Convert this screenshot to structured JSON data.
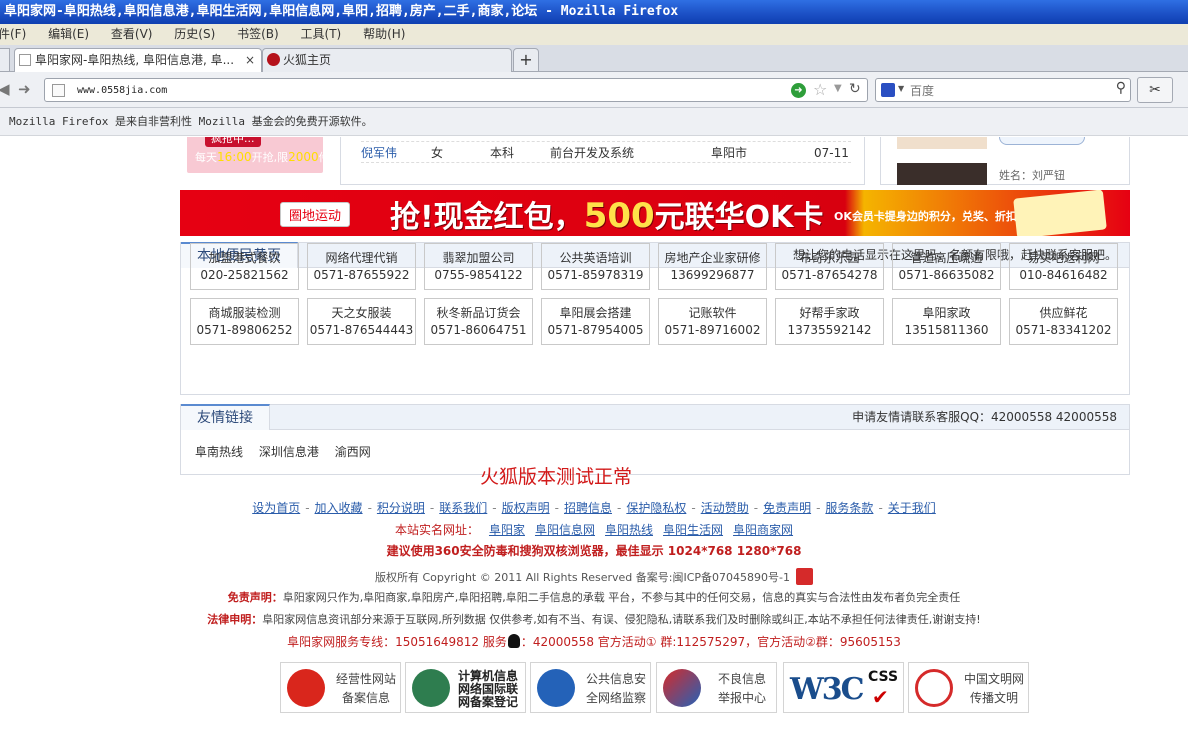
{
  "window": {
    "title": "阜阳家网-阜阳热线,阜阳信息港,阜阳生活网,阜阳信息网,阜阳,招聘,房产,二手,商家,论坛 - Mozilla Firefox"
  },
  "menu": [
    "件(F)",
    "编辑(E)",
    "查看(V)",
    "历史(S)",
    "书签(B)",
    "工具(T)",
    "帮助(H)"
  ],
  "tabs": [
    {
      "label": "阜阳家网-阜阳热线, 阜阳信息港, 阜...",
      "close": "×"
    },
    {
      "label": "火狐主页"
    }
  ],
  "newtab_label": "+",
  "nav": {
    "url": "www.0558jia.com",
    "search_placeholder": "百度"
  },
  "notification": "Mozilla Firefox 是来自非营利性 Mozilla 基金会的免费开源软件。",
  "promo": {
    "title": "疯抢中...",
    "text_prefix": "每天",
    "time": "16:00",
    "text_mid": "开抢,限",
    "count": "2000",
    "text_suffix": "件"
  },
  "job_row": {
    "name": "倪军伟",
    "gender": "女",
    "education": "本科",
    "position": "前台开发及系统",
    "city": "阜阳市",
    "date": "07-11"
  },
  "right_box": {
    "cut_text": "姓名：刘严钮"
  },
  "banner": {
    "tag": "圈地运动",
    "text": "抢!现金红包，",
    "amount": "500",
    "text2": "元联华OK卡",
    "card_note": "OK会员卡提身边的积分，兑奖、折扣卡"
  },
  "yellow_pages": {
    "title": "本地便民黄页",
    "note": "想让您的电话显示在这里吗，名额有限哦，赶快联系客服吧。",
    "entries": [
      {
        "name": "加盟港式餐饮",
        "phone": "020-25821562"
      },
      {
        "name": "网络代理代销",
        "phone": "0571-87655922"
      },
      {
        "name": "翡翠加盟公司",
        "phone": "0755-9854122"
      },
      {
        "name": "公共英语培训",
        "phone": "0571-85978319"
      },
      {
        "name": "房地产企业家研修",
        "phone": "13699296877"
      },
      {
        "name": "布奇乐乐园",
        "phone": "0571-87654278"
      },
      {
        "name": "管道高压疏通",
        "phone": "0571-86635082"
      },
      {
        "name": "易买吧返利网",
        "phone": "010-84616482"
      },
      {
        "name": "商城服装检测",
        "phone": "0571-89806252"
      },
      {
        "name": "天之女服装",
        "phone": "0571-876544443"
      },
      {
        "name": "秋冬新品订货会",
        "phone": "0571-86064751"
      },
      {
        "name": "阜阳展会搭建",
        "phone": "0571-87954005"
      },
      {
        "name": "记账软件",
        "phone": "0571-89716002"
      },
      {
        "name": "好帮手家政",
        "phone": "13735592142"
      },
      {
        "name": "阜阳家政",
        "phone": "13515811360"
      },
      {
        "name": "供应鲜花",
        "phone": "0571-83341202"
      }
    ]
  },
  "friend_links": {
    "title": "友情链接",
    "note": "申请友情请联系客服QQ：42000558 42000558",
    "links": [
      "阜南热线",
      "深圳信息港",
      "渝西网"
    ]
  },
  "test_note": "火狐版本测试正常",
  "footer": {
    "links": [
      "设为首页",
      "加入收藏",
      "积分说明",
      "联系我们",
      "版权声明",
      "招聘信息",
      "保护隐私权",
      "活动赞助",
      "免责声明",
      "服务条款",
      "关于我们"
    ],
    "realname_label": "本站实名网址：",
    "realname_links": [
      "阜阳家",
      "阜阳信息网",
      "阜阳热线",
      "阜阳生活网",
      "阜阳商家网"
    ],
    "advice": "建议使用360安全防毒和搜狗双核浏览器，最佳显示 1024*768 1280*768",
    "copyright": "版权所有 Copyright © 2011 All Rights Reserved 备案号:闽ICP备07045890号-1",
    "disclaimer_label": "免责声明：",
    "disclaimer": "阜阳家网只作为,阜阳商家,阜阳房产,阜阳招聘,阜阳二手信息的承载 平台，不参与其中的任何交易，信息的真实与合法性由发布者负完全责任",
    "legal_label": "法律申明：",
    "legal": "阜阳家网信息资讯部分来源于互联网,所列数据 仅供参考,如有不当、有误、侵犯隐私,请联系我们及时删除或纠正,本站不承担任何法律责任,谢谢支持!",
    "hotline_a": "阜阳家网服务专线：15051649812 服务",
    "hotline_b": "：42000558 官方活动① 群:112575297，官方活动②群：95605153"
  },
  "badges": [
    {
      "line1": "经营性网站",
      "line2": "备案信息"
    },
    {
      "line1": "计算机信息",
      "line2": "网络国际联",
      "line3": "网备案登记"
    },
    {
      "line1": "公共信息安",
      "line2": "全网络监察"
    },
    {
      "line1": "不良信息",
      "line2": "举报中心"
    },
    {
      "line1": "W3C",
      "line2": "CSS"
    },
    {
      "line1": "中国文明网",
      "line2": "传播文明"
    }
  ],
  "colors": {
    "accent_red": "#c01e1e",
    "link_blue": "#2a5caa",
    "title_bar": "#1b4fc4"
  }
}
